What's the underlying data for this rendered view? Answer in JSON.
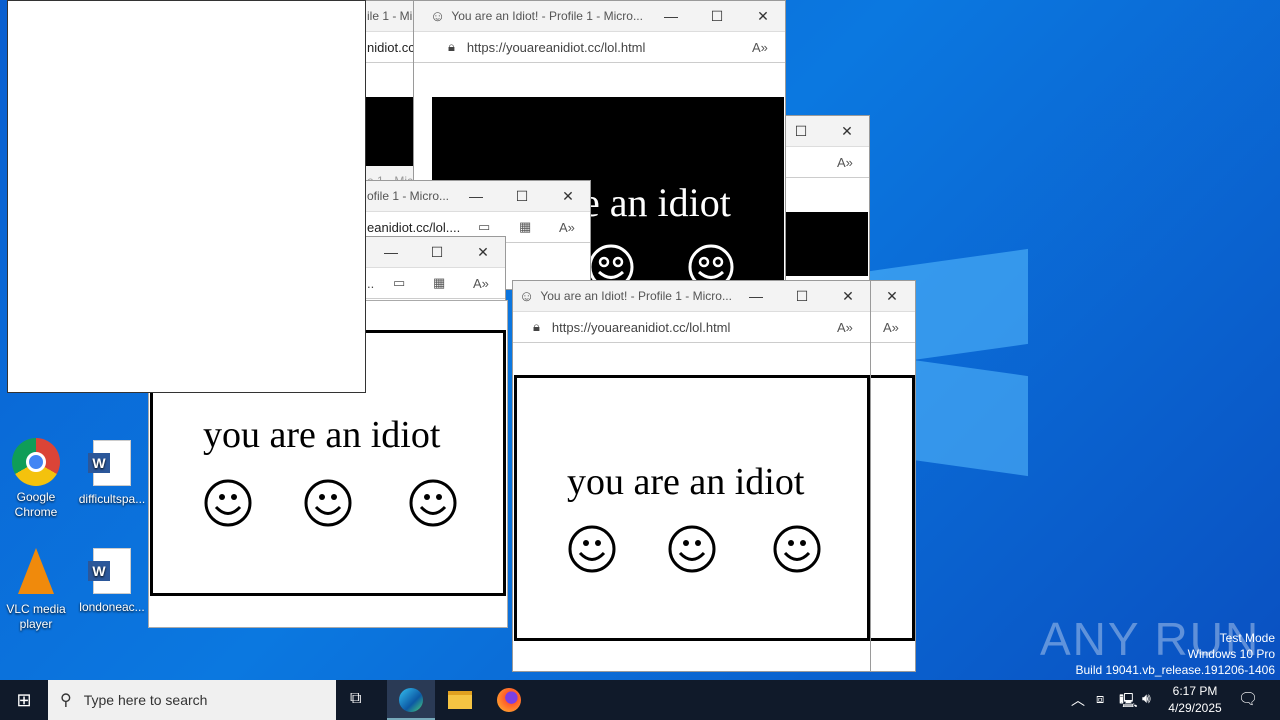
{
  "window_title": "You are an Idiot! - Profile 1 - Micro...",
  "window_title_partial1": "ile 1 - Mi",
  "window_title_partial2": "ofile 1 - Micro...",
  "window_title_partial3": "e 1 - Mic",
  "url": "https://youareanidiot.cc/lol.html",
  "url_partial1": "nidiot.cc",
  "url_partial2": "eanidiot.cc/lol....",
  "url_partial3": "..",
  "page_text": "you are an idiot",
  "page_text_partial": "e an idiot",
  "desktop_icons": [
    {
      "label": "Google Chrome"
    },
    {
      "label": "difficultspa..."
    },
    {
      "label": "VLC media player"
    },
    {
      "label": "londoneac..."
    }
  ],
  "taskbar": {
    "search_placeholder": "Type here to search",
    "time": "6:17 PM",
    "date": "4/29/2025"
  },
  "watermark": {
    "brand": "ANY RUN",
    "line1": "Test Mode",
    "line2": "Windows 10 Pro",
    "line3": "Build 19041.vb_release.191206-1406"
  }
}
